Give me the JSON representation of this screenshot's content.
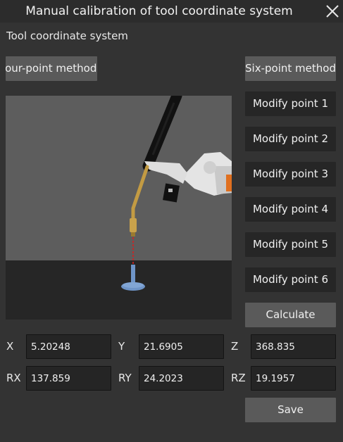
{
  "window": {
    "title": "Manual calibration of tool coordinate system"
  },
  "section": {
    "label": "Tool coordinate system"
  },
  "methods": {
    "four_point": "Four-point method",
    "six_point": "Six-point method"
  },
  "points": [
    {
      "label": "Modify point 1"
    },
    {
      "label": "Modify point 2"
    },
    {
      "label": "Modify point 3"
    },
    {
      "label": "Modify point 4"
    },
    {
      "label": "Modify point 5"
    },
    {
      "label": "Modify point 6"
    }
  ],
  "actions": {
    "calculate": "Calculate",
    "save": "Save"
  },
  "fields": {
    "x": {
      "label": "X",
      "value": "5.20248"
    },
    "y": {
      "label": "Y",
      "value": "21.6905"
    },
    "z": {
      "label": "Z",
      "value": "368.835"
    },
    "rx": {
      "label": "RX",
      "value": "137.859"
    },
    "ry": {
      "label": "RY",
      "value": "24.2023"
    },
    "rz": {
      "label": "RZ",
      "value": "19.1957"
    }
  },
  "icons": {
    "close": "close-icon",
    "preview": "robot-tool-preview"
  },
  "colors": {
    "background": "#333333",
    "button": "#5a5a5a",
    "button_dark": "#262626",
    "field_bg": "#252525",
    "viewport": "#5d5d5d",
    "floor": "#262626",
    "laser": "#d42020",
    "target": "#6f95c8"
  }
}
